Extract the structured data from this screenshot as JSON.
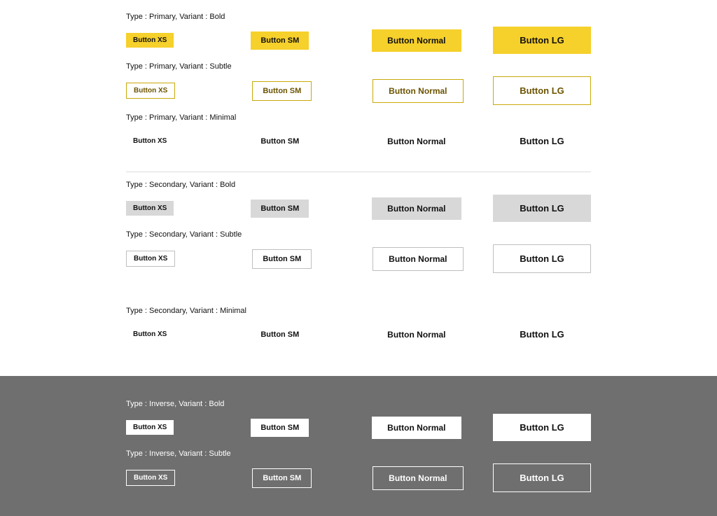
{
  "labels": {
    "xs": "Button XS",
    "sm": "Button SM",
    "md": "Button Normal",
    "lg": "Button LG"
  },
  "groups": {
    "primary_bold": "Type : Primary, Variant : Bold",
    "primary_subtle": "Type : Primary, Variant : Subtle",
    "primary_minimal": "Type : Primary, Variant : Minimal",
    "secondary_bold": "Type : Secondary, Variant : Bold",
    "secondary_subtle": "Type : Secondary, Variant : Subtle",
    "secondary_minimal": "Type : Secondary, Variant : Minimal",
    "inverse_bold": "Type : Inverse, Variant : Bold",
    "inverse_subtle": "Type : Inverse, Variant : Subtle"
  }
}
